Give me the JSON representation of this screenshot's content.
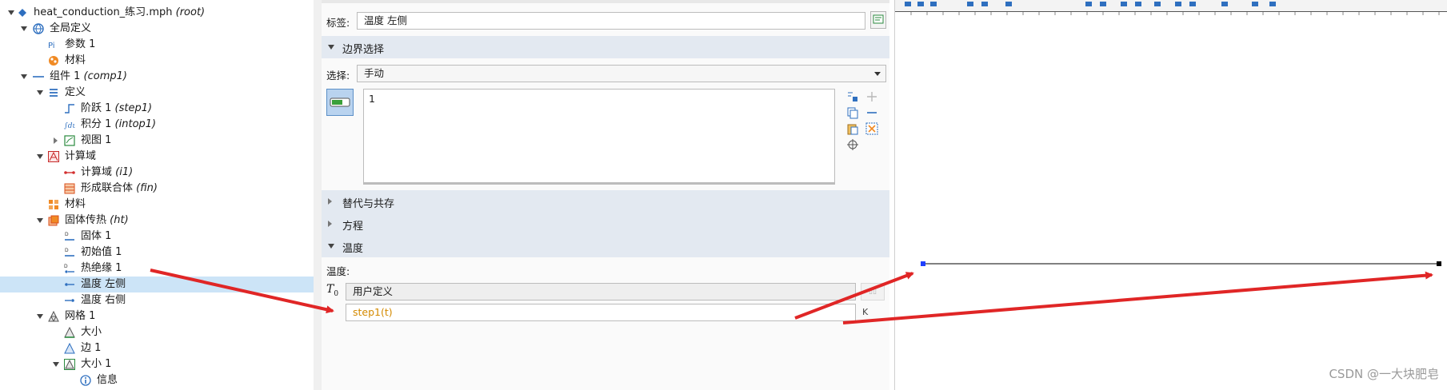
{
  "tree": [
    {
      "label": "heat_conduction_练习.mph",
      "tag": "(root)",
      "icon": "model-icon"
    },
    {
      "label": "全局定义",
      "tag": "",
      "icon": "globe-icon"
    },
    {
      "label": "参数 1",
      "tag": "",
      "icon": "parameters-icon"
    },
    {
      "label": "材料",
      "tag": "",
      "icon": "materials-icon"
    },
    {
      "label": "组件 1",
      "tag": "(comp1)",
      "icon": "component-icon"
    },
    {
      "label": "定义",
      "tag": "",
      "icon": "definitions-icon"
    },
    {
      "label": "阶跃 1",
      "tag": "(step1)",
      "icon": "step-function-icon"
    },
    {
      "label": "积分 1",
      "tag": "(intop1)",
      "icon": "integration-icon"
    },
    {
      "label": "视图 1",
      "tag": "",
      "icon": "view-icon"
    },
    {
      "label": "计算域",
      "tag": "",
      "icon": "geometry-icon"
    },
    {
      "label": "计算域",
      "tag": "(i1)",
      "icon": "interval-icon"
    },
    {
      "label": "形成联合体",
      "tag": "(fin)",
      "icon": "form-union-icon"
    },
    {
      "label": "材料",
      "tag": "",
      "icon": "material-icon"
    },
    {
      "label": "固体传热",
      "tag": "(ht)",
      "icon": "heat-transfer-icon"
    },
    {
      "label": "固体 1",
      "tag": "",
      "icon": "solid-icon"
    },
    {
      "label": "初始值 1",
      "tag": "",
      "icon": "initial-values-icon"
    },
    {
      "label": "热绝缘 1",
      "tag": "",
      "icon": "thermal-insulation-icon"
    },
    {
      "label": "温度 左侧",
      "tag": "",
      "icon": "temperature-icon"
    },
    {
      "label": "温度 右侧",
      "tag": "",
      "icon": "temperature-icon"
    },
    {
      "label": "网格 1",
      "tag": "",
      "icon": "mesh-icon"
    },
    {
      "label": "大小",
      "tag": "",
      "icon": "size-icon"
    },
    {
      "label": "边 1",
      "tag": "",
      "icon": "edge-icon"
    },
    {
      "label": "大小 1",
      "tag": "",
      "icon": "size-icon"
    },
    {
      "label": "信息",
      "tag": "",
      "icon": "info-icon"
    }
  ],
  "settings": {
    "label_caption": "标签:",
    "label_value": "温度 左侧",
    "section_boundary": "边界选择",
    "selection_caption": "选择:",
    "selection_value": "手动",
    "selection_list_item": "1",
    "section_override": "替代与共存",
    "section_equation": "方程",
    "section_temperature": "温度",
    "temperature_caption": "温度:",
    "t0_symbol": "T",
    "t0_sub": "0",
    "t0_mode": "用户定义",
    "t0_expression": "step1(t)"
  },
  "watermark": "CSDN @一大块肥皂",
  "colors": {
    "selected_row": "#cce4f7",
    "section_header": "#e3e9f1",
    "expression_text": "#d48a00",
    "annotation_arrow": "#e02626",
    "point_marker": "#1f3fff"
  }
}
